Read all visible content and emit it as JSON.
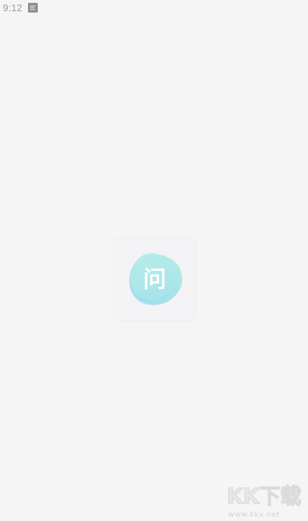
{
  "status_bar": {
    "time": "9:12",
    "notification_icon": "app-notification-icon"
  },
  "splash": {
    "logo_icon": "question-logo-icon",
    "logo_glyph": "问",
    "colors": {
      "background": "#f6f5f6",
      "card": "#f3f3f5",
      "blob_green": "#a8ead7",
      "blob_blue": "#9ed9f0",
      "blob_cyan": "#b6f0ea",
      "glyph": "#ffffff"
    }
  },
  "watermark": {
    "brand": "KK下载",
    "url": "www.kkx.net"
  }
}
